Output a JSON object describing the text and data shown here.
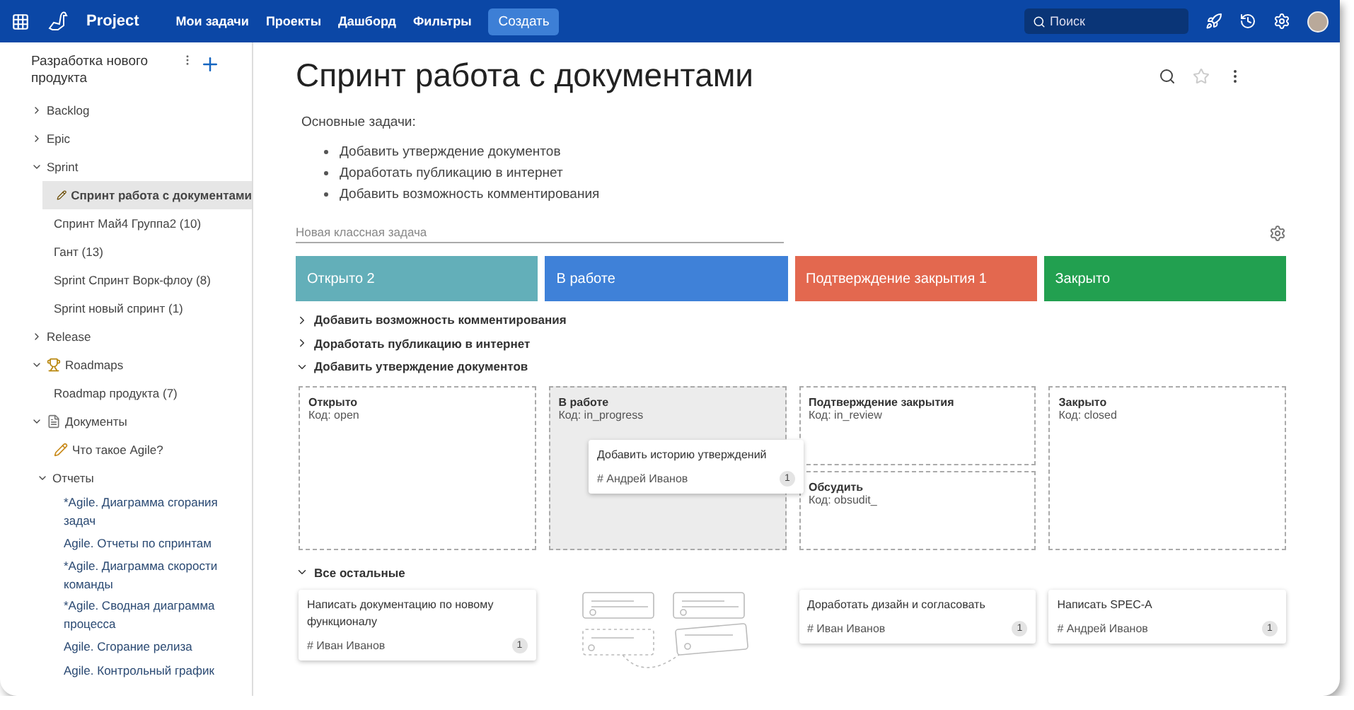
{
  "topbar": {
    "product": "Project",
    "nav": [
      {
        "label": "Мои задачи"
      },
      {
        "label": "Проекты"
      },
      {
        "label": "Дашборд"
      },
      {
        "label": "Фильтры"
      }
    ],
    "create": "Создать",
    "search": {
      "placeholder": "Поиск"
    }
  },
  "sidebar": {
    "title": "Разработка нового продукта",
    "items": [
      {
        "label": "Backlog",
        "kind": "group",
        "expanded": false
      },
      {
        "label": "Epic",
        "kind": "group",
        "expanded": false
      },
      {
        "label": "Sprint",
        "kind": "group",
        "expanded": true,
        "children": [
          {
            "label": "Спринт работа с документами",
            "kind": "board",
            "selected": true
          },
          {
            "label": "Спринт Май4 Группа2 (10)",
            "kind": "leaf",
            "selected": false
          },
          {
            "label": "Гант (13)",
            "kind": "leaf",
            "selected": false
          },
          {
            "label": "Sprint Спринт Ворк-флоу (8)",
            "kind": "leaf",
            "selected": false
          },
          {
            "label": "Sprint новый спринт (1)",
            "kind": "leaf",
            "selected": false
          }
        ]
      },
      {
        "label": "Release",
        "kind": "group",
        "expanded": false
      },
      {
        "label": "Roadmaps",
        "kind": "trophy",
        "expanded": true,
        "children": [
          {
            "label": "Roadmap продукта (7)",
            "kind": "leaf",
            "selected": false
          }
        ]
      },
      {
        "label": "Документы",
        "kind": "document",
        "expanded": true,
        "children": [
          {
            "label": "Что такое Agile?",
            "kind": "page",
            "selected": false
          },
          {
            "label": "Отчеты",
            "kind": "group",
            "expanded": true,
            "children": [
              {
                "label": "*Agile. Диаграмма сгорания задач",
                "kind": "report",
                "selected": false
              },
              {
                "label": "Agile. Отчеты по спринтам",
                "kind": "report",
                "selected": false
              },
              {
                "label": "*Agile. Диаграмма скорости команды",
                "kind": "report",
                "selected": false
              },
              {
                "label": "*Agile. Сводная диаграмма процесса",
                "kind": "report",
                "selected": false
              },
              {
                "label": "Agile. Сгорание релиза",
                "kind": "report",
                "selected": false
              },
              {
                "label": "Agile. Контрольный график",
                "kind": "report",
                "selected": false
              }
            ]
          }
        ]
      }
    ]
  },
  "page": {
    "title": "Спринт работа с документами",
    "intro": "Основные задачи:",
    "tasks": [
      "Добавить утверждение документов",
      "Доработать публикацию в интернет",
      "Добавить возможность комментирования"
    ],
    "new_task": {
      "placeholder": "Новая классная задача"
    }
  },
  "columns": [
    {
      "label": "Открыто 2",
      "color": "#63afb9"
    },
    {
      "label": "В работе",
      "color": "#3f81d8"
    },
    {
      "label": "Подтверждение закрытия 1",
      "color": "#e3684f"
    },
    {
      "label": "Закрыто",
      "color": "#22a050"
    }
  ],
  "lanes": [
    {
      "title": "Добавить возможность комментирования",
      "expanded": false
    },
    {
      "title": "Доработать публикацию в интернет",
      "expanded": false
    },
    {
      "title": "Добавить утверждение документов",
      "expanded": true,
      "zones": [
        [
          {
            "name": "Открыто",
            "code": "Код: open",
            "highlighted": false
          }
        ],
        [
          {
            "name": "В работе",
            "code": "Код: in_progress",
            "highlighted": true
          }
        ],
        [
          {
            "name": "Подтверждение закрытия",
            "code": "Код: in_review",
            "highlighted": false
          },
          {
            "name": "Обсудить",
            "code": "Код: obsudit_",
            "highlighted": false
          }
        ],
        [
          {
            "name": "Закрыто",
            "code": "Код: closed",
            "highlighted": false
          }
        ]
      ],
      "dragged_card": {
        "title": "Добавить историю утверждений",
        "assignee": "# Андрей Иванов",
        "count": "1"
      }
    },
    {
      "title": "Все остальные",
      "expanded": true,
      "cells": [
        {
          "kind": "card",
          "title": "Написать документацию по новому функционалу",
          "assignee": "# Иван Иванов",
          "count": "1"
        },
        {
          "kind": "empty"
        },
        {
          "kind": "card",
          "title": "Доработать дизайн и согласовать",
          "assignee": "# Иван Иванов",
          "count": "1"
        },
        {
          "kind": "card",
          "title": "Написать SPEC-A",
          "assignee": "# Андрей Иванов",
          "count": "1"
        }
      ]
    }
  ]
}
